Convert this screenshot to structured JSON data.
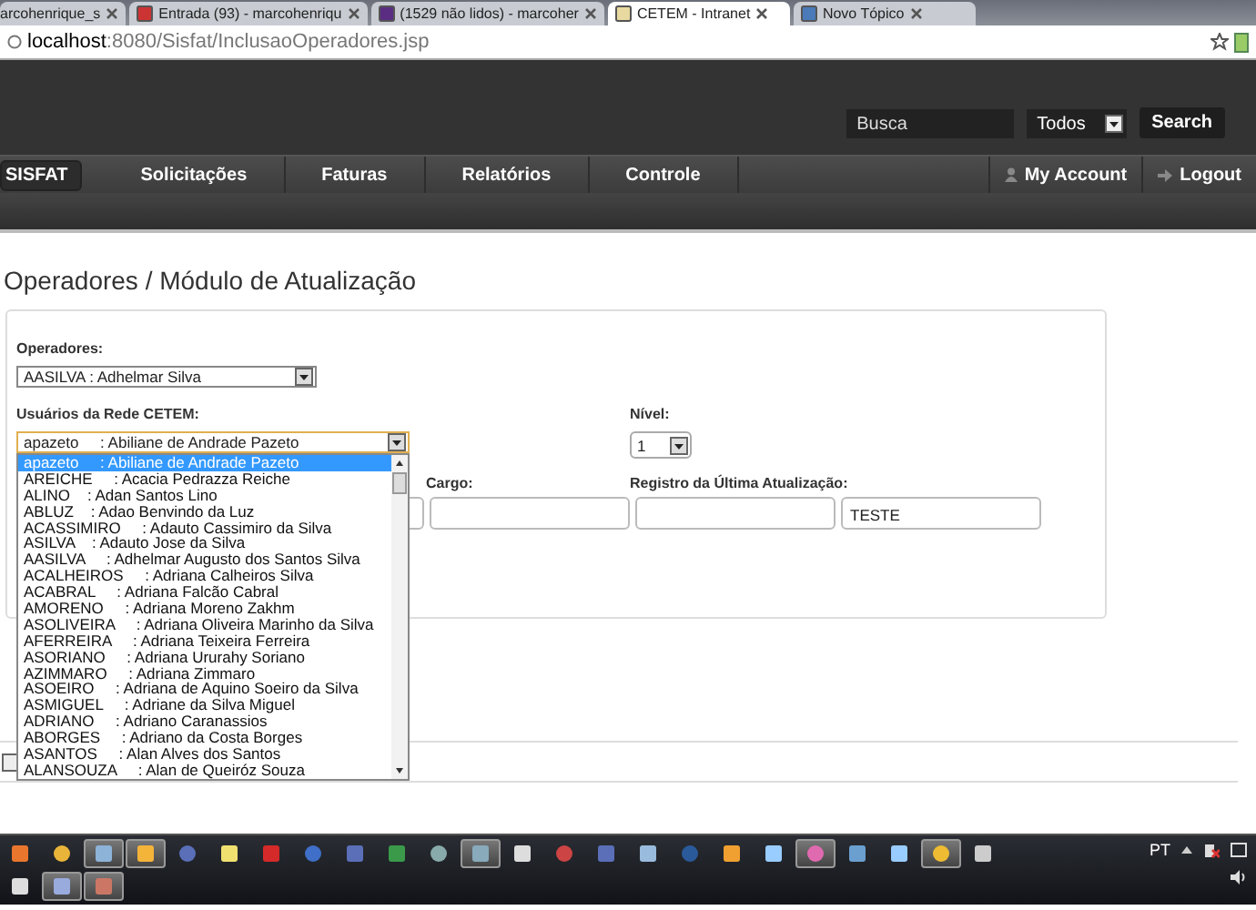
{
  "browser": {
    "tabs": [
      {
        "label": "arcohenrique_s",
        "selected": false
      },
      {
        "label": "Entrada (93) - marcohenriqu",
        "selected": false
      },
      {
        "label": "(1529 não lidos) - marcoher",
        "selected": false
      },
      {
        "label": "CETEM - Intranet",
        "selected": true
      },
      {
        "label": "Novo Tópico",
        "selected": false
      }
    ],
    "address": {
      "host": "localhost",
      "path": ":8080/Sisfat/InclusaoOperadores.jsp"
    }
  },
  "header": {
    "search": {
      "placeholder": "Busca"
    },
    "filter": "Todos",
    "search_button": "Search",
    "nav": [
      {
        "label": "SISFAT",
        "selected": true
      },
      {
        "label": "Solicitações",
        "selected": false
      },
      {
        "label": "Faturas",
        "selected": false
      },
      {
        "label": "Relatórios",
        "selected": false
      },
      {
        "label": "Controle",
        "selected": false
      }
    ],
    "account": "My Account",
    "logout": "Logout"
  },
  "page_title": "Operadores / Módulo de Atualização",
  "form": {
    "operadores": {
      "label": "Operadores:",
      "value": "AASILVA : Adhelmar Silva"
    },
    "usuarios": {
      "label": "Usuários da Rede CETEM:",
      "value": "apazeto     : Abiliane de Andrade Pazeto",
      "expanded": true,
      "options": [
        {
          "label": "apazeto     : Abiliane de Andrade Pazeto",
          "selected": true
        },
        {
          "label": "AREICHE     : Acacia Pedrazza Reiche",
          "selected": false
        },
        {
          "label": "ALINO    : Adan Santos Lino",
          "selected": false
        },
        {
          "label": "ABLUZ    : Adao Benvindo da Luz",
          "selected": false
        },
        {
          "label": "ACASSIMIRO     : Adauto Cassimiro da Silva",
          "selected": false
        },
        {
          "label": "ASILVA    : Adauto Jose da Silva",
          "selected": false
        },
        {
          "label": "AASILVA     : Adhelmar Augusto dos Santos Silva",
          "selected": false
        },
        {
          "label": "ACALHEIROS     : Adriana Calheiros Silva",
          "selected": false
        },
        {
          "label": "ACABRAL     : Adriana Falcão Cabral",
          "selected": false
        },
        {
          "label": "AMORENO     : Adriana Moreno Zakhm",
          "selected": false
        },
        {
          "label": "ASOLIVEIRA     : Adriana Oliveira Marinho da Silva",
          "selected": false
        },
        {
          "label": "AFERREIRA     : Adriana Teixeira Ferreira",
          "selected": false
        },
        {
          "label": "ASORIANO     : Adriana Ururahy Soriano",
          "selected": false
        },
        {
          "label": "AZIMMARO     : Adriana Zimmaro",
          "selected": false
        },
        {
          "label": "ASOEIRO     : Adriana de Aquino Soeiro da Silva",
          "selected": false
        },
        {
          "label": "ASMIGUEL     : Adriane da Silva Miguel",
          "selected": false
        },
        {
          "label": "ADRIANO     : Adriano Caranassios",
          "selected": false
        },
        {
          "label": "ABORGES     : Adriano da Costa Borges",
          "selected": false
        },
        {
          "label": "ASANTOS     : Alan Alves dos Santos",
          "selected": false
        },
        {
          "label": "ALANSOUZA     : Alan de Queiróz Souza",
          "selected": false
        }
      ]
    },
    "nivel": {
      "label": "Nível:",
      "value": "1"
    },
    "cargo": {
      "label": "Cargo:"
    },
    "registro": {
      "label": "Registro da Última Atualização:",
      "value": "TESTE"
    }
  },
  "taskbar": {
    "language": "PT"
  }
}
